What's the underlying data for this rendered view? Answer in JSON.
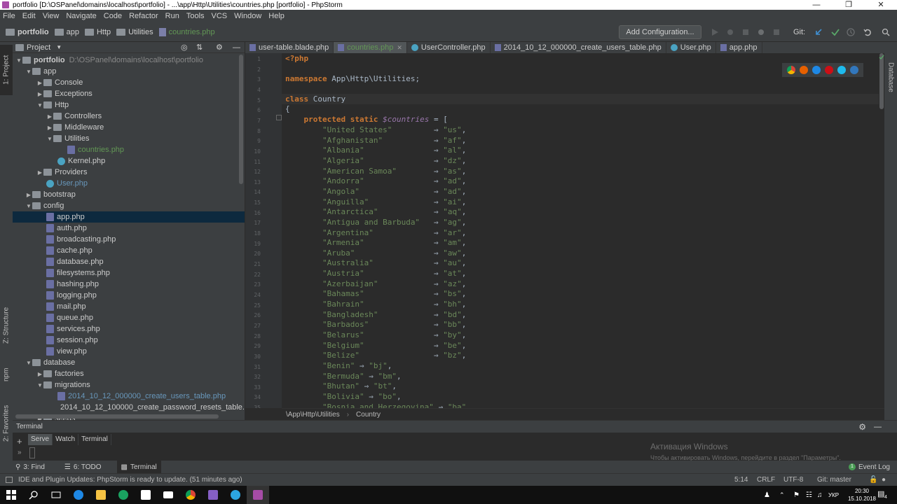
{
  "window": {
    "title": "portfolio [D:\\OSPanel\\domains\\localhost\\portfolio] - ...\\app\\Http\\Utilities\\countries.php [portfolio] - PhpStorm"
  },
  "menu": [
    "File",
    "Edit",
    "View",
    "Navigate",
    "Code",
    "Refactor",
    "Run",
    "Tools",
    "VCS",
    "Window",
    "Help"
  ],
  "navbar": {
    "crumbs": [
      "portfolio",
      "app",
      "Http",
      "Utilities",
      "countries.php"
    ],
    "add_configuration": "Add Configuration...",
    "git_label": "Git:"
  },
  "left_strip": {
    "project": "1: Project",
    "structure": "Z: Structure",
    "npm": "npm",
    "favorites": "2: Favorites"
  },
  "right_strip": {
    "database": "Database"
  },
  "project_panel": {
    "header": "Project",
    "root_path": "D:\\OSPanel\\domains\\localhost\\portfolio",
    "tree": [
      {
        "label": "portfolio"
      },
      {
        "label": "app"
      },
      {
        "label": "Console"
      },
      {
        "label": "Exceptions"
      },
      {
        "label": "Http"
      },
      {
        "label": "Controllers"
      },
      {
        "label": "Middleware"
      },
      {
        "label": "Utilities"
      },
      {
        "label": "countries.php"
      },
      {
        "label": "Kernel.php"
      },
      {
        "label": "Providers"
      },
      {
        "label": "User.php"
      },
      {
        "label": "bootstrap"
      },
      {
        "label": "config"
      },
      {
        "label": "app.php"
      },
      {
        "label": "auth.php"
      },
      {
        "label": "broadcasting.php"
      },
      {
        "label": "cache.php"
      },
      {
        "label": "database.php"
      },
      {
        "label": "filesystems.php"
      },
      {
        "label": "hashing.php"
      },
      {
        "label": "logging.php"
      },
      {
        "label": "mail.php"
      },
      {
        "label": "queue.php"
      },
      {
        "label": "services.php"
      },
      {
        "label": "session.php"
      },
      {
        "label": "view.php"
      },
      {
        "label": "database"
      },
      {
        "label": "factories"
      },
      {
        "label": "migrations"
      },
      {
        "label": "2014_10_12_000000_create_users_table.php"
      },
      {
        "label": "2014_10_12_100000_create_password_resets_table.p"
      },
      {
        "label": "seeds"
      }
    ]
  },
  "editor_tabs": [
    {
      "label": "user-table.blade.php"
    },
    {
      "label": "countries.php"
    },
    {
      "label": "UserController.php"
    },
    {
      "label": "2014_10_12_000000_create_users_table.php"
    },
    {
      "label": "User.php"
    },
    {
      "label": "app.php"
    }
  ],
  "code": {
    "line_numbers": [
      "1",
      "2",
      "3",
      "4",
      "5",
      "6",
      "7",
      "8",
      "9",
      "10",
      "11",
      "12",
      "13",
      "14",
      "15",
      "16",
      "17",
      "18",
      "19",
      "20",
      "21",
      "22",
      "23",
      "24",
      "25",
      "26",
      "27",
      "28",
      "29",
      "30",
      "31",
      "32",
      "33",
      "34",
      "35"
    ],
    "open_tag": "<?php",
    "namespace_kw": "namespace",
    "namespace_value": "App\\Http\\Utilities;",
    "class_kw": "class",
    "class_name": "Country",
    "open_brace": "{",
    "prop_kw": "protected static",
    "prop_var": "$countries",
    "prop_assign": " = [",
    "entries": [
      {
        "name": "\"United States\"",
        "pad": "         ",
        "code": "\"us\""
      },
      {
        "name": "\"Afghanistan\"",
        "pad": "           ",
        "code": "\"af\""
      },
      {
        "name": "\"Albania\"",
        "pad": "               ",
        "code": "\"al\""
      },
      {
        "name": "\"Algeria\"",
        "pad": "               ",
        "code": "\"dz\""
      },
      {
        "name": "\"American Samoa\"",
        "pad": "        ",
        "code": "\"as\""
      },
      {
        "name": "\"Andorra\"",
        "pad": "               ",
        "code": "\"ad\""
      },
      {
        "name": "\"Angola\"",
        "pad": "                ",
        "code": "\"ad\""
      },
      {
        "name": "\"Anguilla\"",
        "pad": "              ",
        "code": "\"ai\""
      },
      {
        "name": "\"Antarctica\"",
        "pad": "            ",
        "code": "\"aq\""
      },
      {
        "name": "\"Antigua and Barbuda\"",
        "pad": "   ",
        "code": "\"ag\""
      },
      {
        "name": "\"Argentina\"",
        "pad": "             ",
        "code": "\"ar\""
      },
      {
        "name": "\"Armenia\"",
        "pad": "               ",
        "code": "\"am\""
      },
      {
        "name": "\"Aruba\"",
        "pad": "                 ",
        "code": "\"aw\""
      },
      {
        "name": "\"Australia\"",
        "pad": "             ",
        "code": "\"au\""
      },
      {
        "name": "\"Austria\"",
        "pad": "               ",
        "code": "\"at\""
      },
      {
        "name": "\"Azerbaijan\"",
        "pad": "            ",
        "code": "\"az\""
      },
      {
        "name": "\"Bahamas\"",
        "pad": "               ",
        "code": "\"bs\""
      },
      {
        "name": "\"Bahrain\"",
        "pad": "               ",
        "code": "\"bh\""
      },
      {
        "name": "\"Bangladesh\"",
        "pad": "            ",
        "code": "\"bd\""
      },
      {
        "name": "\"Barbados\"",
        "pad": "              ",
        "code": "\"bb\""
      },
      {
        "name": "\"Belarus\"",
        "pad": "               ",
        "code": "\"by\""
      },
      {
        "name": "\"Belgium\"",
        "pad": "               ",
        "code": "\"be\""
      },
      {
        "name": "\"Belize\"",
        "pad": "                ",
        "code": "\"bz\""
      },
      {
        "name": "\"Benin\"",
        "pad": " ",
        "code": "\"bj\""
      },
      {
        "name": "\"Bermuda\"",
        "pad": " ",
        "code": "\"bm\""
      },
      {
        "name": "\"Bhutan\"",
        "pad": " ",
        "code": "\"bt\""
      },
      {
        "name": "\"Bolivia\"",
        "pad": " ",
        "code": "\"bo\""
      },
      {
        "name": "\"Bosnia and Herzegovina\"",
        "pad": " ",
        "code": "\"ba\""
      }
    ]
  },
  "breadcrumbs": [
    "\\App\\Http\\Utilities",
    "Country"
  ],
  "terminal": {
    "title": "Terminal",
    "tabs": [
      "Serve",
      "Watch",
      "Terminal"
    ],
    "activation_title": "Активация Windows",
    "activation_text": "Чтобы активировать Windows, перейдите в раздел \"Параметры\"."
  },
  "toolstrip": {
    "find": "3: Find",
    "todo": "6: TODO",
    "terminal": "Terminal",
    "event_log": "Event Log",
    "event_count": "1"
  },
  "statusbar": {
    "message": "IDE and Plugin Updates: PhpStorm is ready to update. (51 minutes ago)",
    "position": "5:14",
    "line_sep": "CRLF",
    "encoding": "UTF-8",
    "git": "Git: master"
  },
  "taskbar": {
    "lang": "УКР",
    "time": "20:30",
    "date": "15.10.2018",
    "notifications": "4"
  },
  "colors": {
    "keyword": "#cc7832",
    "string": "#6a8759",
    "variable": "#9876aa",
    "selection": "#0d293e",
    "active_tab_text": "#629755"
  }
}
